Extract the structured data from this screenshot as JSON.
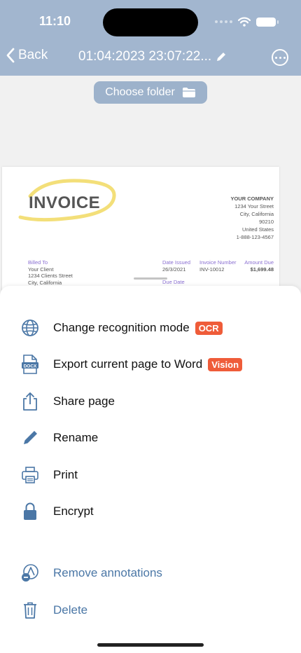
{
  "status": {
    "time": "11:10"
  },
  "nav": {
    "back_label": "Back",
    "title": "01:04:2023 23:07:22..."
  },
  "folder_button": {
    "label": "Choose folder"
  },
  "invoice": {
    "heading": "INVOICE",
    "company": [
      "YOUR COMPANY",
      "1234 Your Street",
      "City, California",
      "90210",
      "United States",
      "1-888-123-4567"
    ],
    "billed_label": "Billed To",
    "billed": [
      "Your Client",
      "1234 Clients Street",
      "City, California"
    ],
    "date_issued_label": "Date Issued",
    "date_issued": "26/3/2021",
    "due_date_label": "Due Date",
    "invoice_number_label": "Invoice Number",
    "invoice_number": "INV-10012",
    "amount_due_label": "Amount Due",
    "amount_due": "$1,699.48"
  },
  "menu": {
    "recognition": {
      "label": "Change recognition mode",
      "badge": "OCR",
      "icon": "globe-icon"
    },
    "export_word": {
      "label": "Export current page to Word",
      "badge": "Vision",
      "icon": "docx-icon"
    },
    "share": {
      "label": "Share page",
      "icon": "share-icon"
    },
    "rename": {
      "label": "Rename",
      "icon": "pencil-icon"
    },
    "print": {
      "label": "Print",
      "icon": "printer-icon"
    },
    "encrypt": {
      "label": "Encrypt",
      "icon": "lock-icon"
    },
    "remove_annotations": {
      "label": "Remove annotations",
      "icon": "remove-annotation-icon"
    },
    "delete": {
      "label": "Delete",
      "icon": "trash-icon"
    }
  },
  "colors": {
    "header": "#a2b6cf",
    "accent": "#4b77a6",
    "badge": "#ef5c39"
  }
}
